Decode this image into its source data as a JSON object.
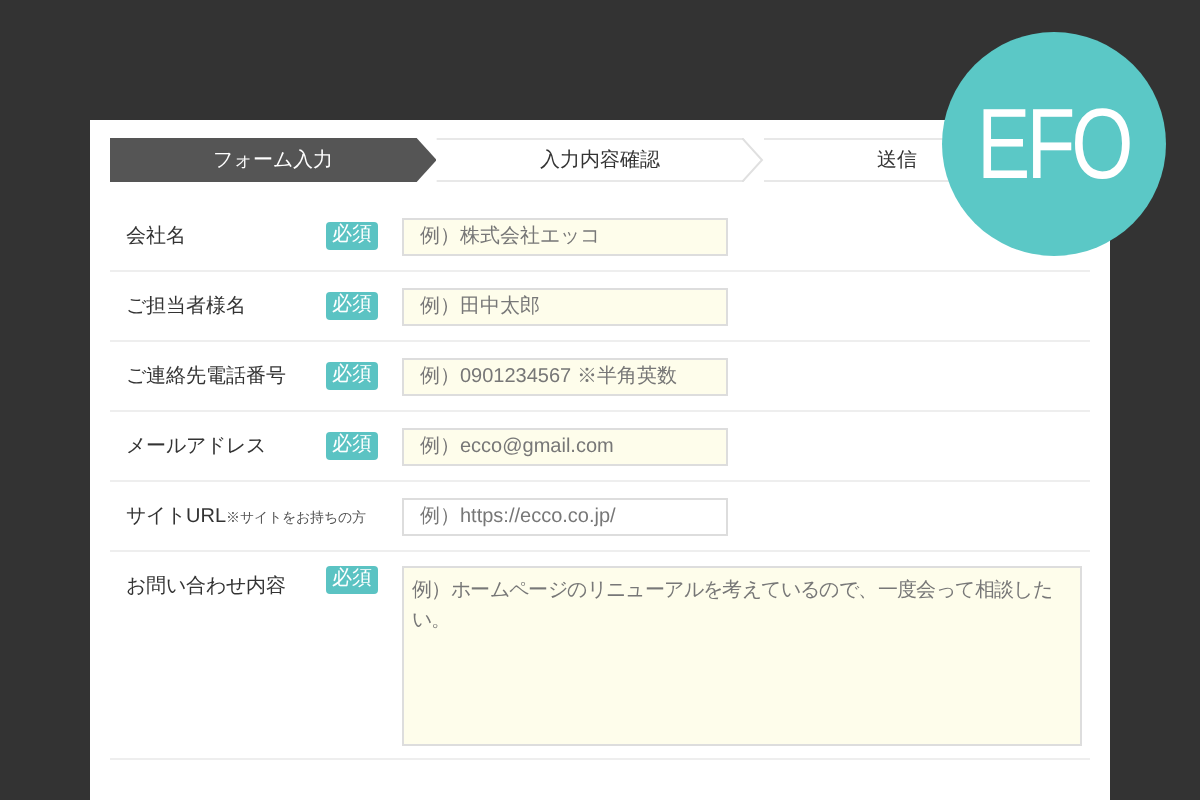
{
  "steps": [
    {
      "label": "フォーム入力",
      "selected": true
    },
    {
      "label": "入力内容確認",
      "selected": false
    },
    {
      "label": "送信",
      "selected": false
    }
  ],
  "fields": [
    {
      "kind": "input",
      "label": "会社名",
      "required": true,
      "required_label": "必須",
      "placeholder": "例）株式会社エッコ"
    },
    {
      "kind": "input",
      "label": "ご担当者様名",
      "required": true,
      "required_label": "必須",
      "placeholder": "例）田中太郎"
    },
    {
      "kind": "input",
      "label": "ご連絡先電話番号",
      "required": true,
      "required_label": "必須",
      "placeholder": "例）0901234567 ※半角英数"
    },
    {
      "kind": "input",
      "label": "メールアドレス",
      "required": true,
      "required_label": "必須",
      "placeholder": "例）ecco@gmail.com"
    },
    {
      "kind": "input",
      "label": "サイトURL",
      "note": "※サイトをお持ちの方",
      "required": false,
      "placeholder": "例）https://ecco.co.jp/"
    },
    {
      "kind": "textarea",
      "label": "お問い合わせ内容",
      "required": true,
      "required_label": "必須",
      "placeholder": "例）ホームページのリニューアルを考えているので、一度会って相談したい。"
    }
  ],
  "logo": {
    "text": "EFO"
  }
}
